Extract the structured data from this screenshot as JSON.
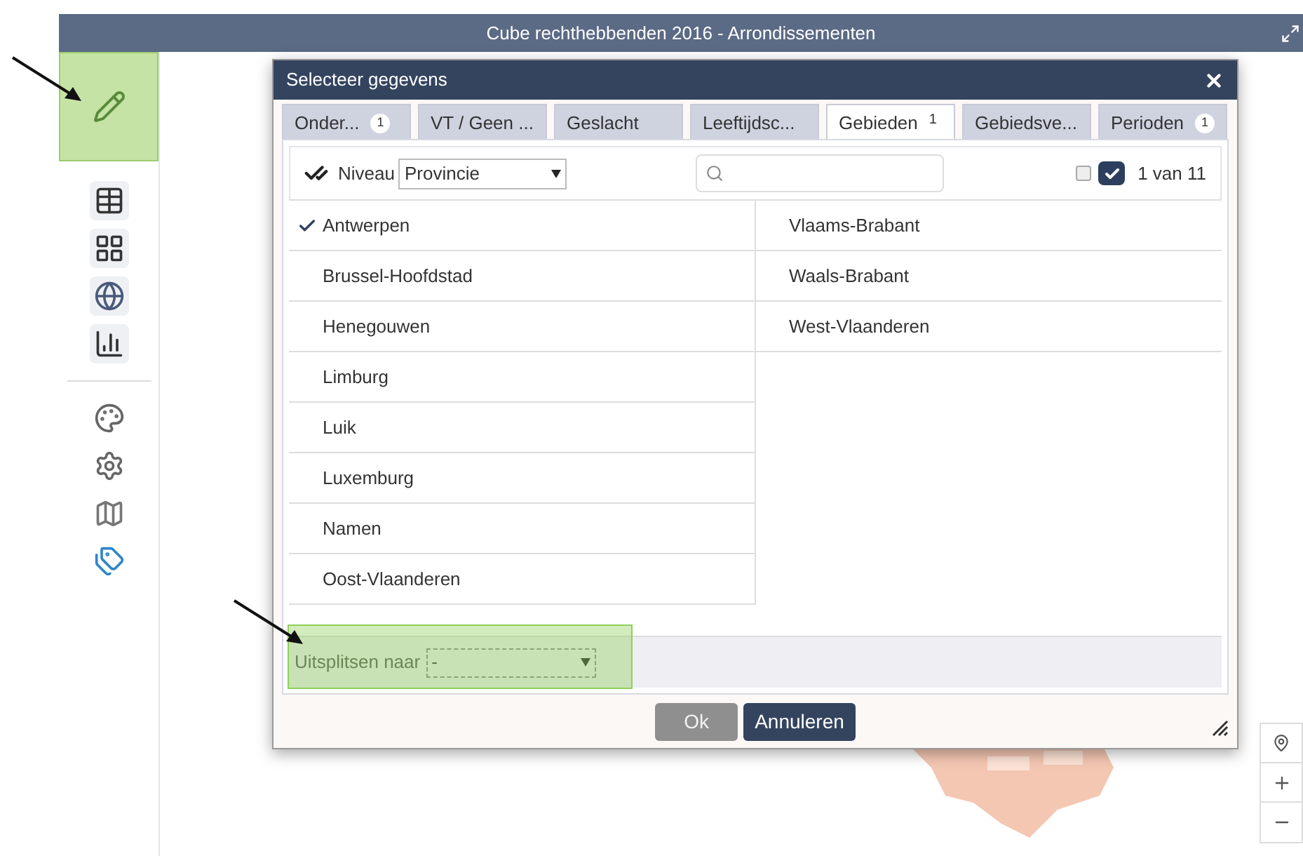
{
  "window": {
    "title": "Cube rechthebbenden 2016 - Arrondissementen"
  },
  "sidebar": {
    "items": [
      {
        "kind": "edit",
        "highlighted": true
      },
      {
        "kind": "table",
        "highlighted": false
      },
      {
        "kind": "detail-table",
        "highlighted": false
      },
      {
        "kind": "globe",
        "highlighted": false
      },
      {
        "kind": "chart",
        "highlighted": false
      },
      {
        "kind": "palette",
        "highlighted": false
      },
      {
        "kind": "gear",
        "highlighted": false
      },
      {
        "kind": "map",
        "highlighted": false
      },
      {
        "kind": "tags",
        "highlighted": false
      }
    ]
  },
  "dialog": {
    "title": "Selecteer gegevens",
    "tabs": [
      {
        "label": "Onder...",
        "badge": "1",
        "selected": false
      },
      {
        "label": "VT / Geen ...",
        "selected": false
      },
      {
        "label": "Geslacht",
        "selected": false
      },
      {
        "label": "Leeftijdsc...",
        "selected": false
      },
      {
        "label": "Gebieden",
        "badge": "1",
        "selected": true
      },
      {
        "label": "Gebiedsve...",
        "selected": false
      },
      {
        "label": "Perioden",
        "badge": "1",
        "selected": false
      }
    ],
    "level_label": "Niveau",
    "level_value": "Provincie",
    "select_none_checked": false,
    "select_all_checked": true,
    "count": "1 van 11",
    "columns": [
      [
        {
          "label": "Antwerpen",
          "checked": true
        },
        {
          "label": "Brussel-Hoofdstad",
          "checked": false
        },
        {
          "label": "Henegouwen",
          "checked": false
        },
        {
          "label": "Limburg",
          "checked": false
        },
        {
          "label": "Luik",
          "checked": false
        },
        {
          "label": "Luxemburg",
          "checked": false
        },
        {
          "label": "Namen",
          "checked": false
        },
        {
          "label": "Oost-Vlaanderen",
          "checked": false
        }
      ],
      [
        {
          "label": "Vlaams-Brabant",
          "checked": false
        },
        {
          "label": "Waals-Brabant",
          "checked": false
        },
        {
          "label": "West-Vlaanderen",
          "checked": false
        }
      ]
    ],
    "split_label": "Uitsplitsen naar",
    "split_value": "-",
    "split_highlighted": true,
    "buttons": [
      {
        "label": "Ok",
        "disabled": true
      },
      {
        "label": "Annuleren",
        "disabled": false
      }
    ]
  }
}
